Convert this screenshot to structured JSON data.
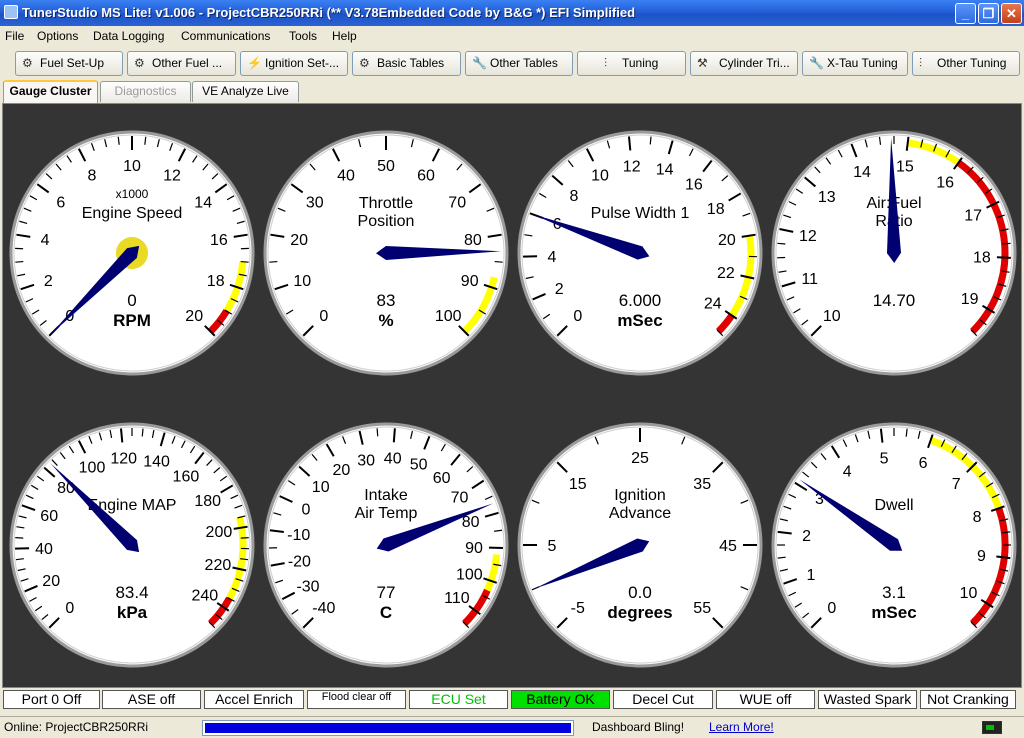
{
  "window": {
    "title": "TunerStudio MS Lite! v1.006 - ProjectCBR250RRi (** V3.78Embedded Code by B&G *) EFI Simplified",
    "minimize": "_",
    "maximize": "❐",
    "close": "✕"
  },
  "menu": [
    "File",
    "Options",
    "Data Logging",
    "Communications",
    "Tools",
    "Help"
  ],
  "toolbar": [
    {
      "label": "Fuel Set-Up",
      "icon": "engine-icon"
    },
    {
      "label": "Other Fuel ...",
      "icon": "engine-icon"
    },
    {
      "label": "Ignition Set-...",
      "icon": "spark-plug-icon"
    },
    {
      "label": "Basic Tables",
      "icon": "engine-icon"
    },
    {
      "label": "Other Tables",
      "icon": "wrench-icon"
    },
    {
      "label": "Tuning",
      "icon": "tuning-icon"
    },
    {
      "label": "Cylinder Tri...",
      "icon": "hammer-icon"
    },
    {
      "label": "X-Tau Tuning",
      "icon": "wrench-icon"
    },
    {
      "label": "Other Tuning",
      "icon": "tuning-icon"
    }
  ],
  "tabs": [
    {
      "label": "Gauge Cluster",
      "state": "active"
    },
    {
      "label": "Diagnostics",
      "state": "disabled"
    },
    {
      "label": "VE Analyze Live",
      "state": "normal"
    }
  ],
  "gauges": [
    {
      "title": [
        "Engine Speed"
      ],
      "top_label": "x1000",
      "value": "0",
      "units": "RPM",
      "min": 0,
      "max": 20,
      "major_step": 2,
      "minor_per_major": 4,
      "current": 0,
      "warn_from": 17,
      "danger_from": 19,
      "label_text": [
        "0",
        "2",
        "4",
        "6",
        "8",
        "10",
        "12",
        "14",
        "16",
        "18",
        "20"
      ]
    },
    {
      "title": [
        "Throttle",
        "Position"
      ],
      "value": "83",
      "units": "%",
      "min": 0,
      "max": 100,
      "major_step": 10,
      "minor_per_major": 2,
      "current": 83,
      "warn_from": 88,
      "danger_from": null,
      "label_text": [
        "0",
        "10",
        "20",
        "30",
        "40",
        "50",
        "60",
        "70",
        "80",
        "90",
        "100"
      ]
    },
    {
      "title": [
        "Pulse Width 1"
      ],
      "value": "6.000",
      "units": "mSec",
      "min": 0,
      "max": 25,
      "major_step": 2,
      "minor_per_major": 2,
      "current": 6,
      "warn_from": 20,
      "danger_from": 24,
      "label_text": [
        "0",
        "2",
        "4",
        "6",
        "8",
        "10",
        "12",
        "14",
        "16",
        "18",
        "20",
        "22",
        "24"
      ]
    },
    {
      "title": [
        "Air:Fuel",
        "Ratio"
      ],
      "value": "14.70",
      "units": "",
      "min": 10,
      "max": 19.5,
      "major_step": 1,
      "minor_per_major": 4,
      "current": 14.7,
      "warn_from": 15,
      "danger_from": 16,
      "label_text": [
        "10",
        "11",
        "12",
        "13",
        "14",
        "15",
        "16",
        "17",
        "18",
        "19"
      ]
    },
    {
      "title": [
        "Engine MAP"
      ],
      "value": "83.4",
      "units": "kPa",
      "min": 0,
      "max": 250,
      "major_step": 20,
      "minor_per_major": 4,
      "current": 83.4,
      "warn_from": 195,
      "danger_from": 235,
      "label_text": [
        "0",
        "20",
        "40",
        "60",
        "80",
        "100",
        "120",
        "140",
        "160",
        "180",
        "200",
        "220",
        "240"
      ]
    },
    {
      "title": [
        "Intake",
        "Air Temp"
      ],
      "value": "77",
      "units": "C",
      "min": -40,
      "max": 115,
      "major_step": 10,
      "minor_per_major": 2,
      "current": 77,
      "warn_from": 92,
      "danger_from": 103,
      "label_text": [
        "-40",
        "-30",
        "-20",
        "-10",
        "0",
        "10",
        "20",
        "30",
        "40",
        "50",
        "60",
        "70",
        "80",
        "90",
        "100",
        "110"
      ]
    },
    {
      "title": [
        "Ignition",
        "Advance"
      ],
      "value": "0.0",
      "units": "degrees",
      "min": -5,
      "max": 55,
      "major_step": 10,
      "minor_per_major": 2,
      "current": 0,
      "warn_from": null,
      "danger_from": null,
      "label_text": [
        "-5",
        "5",
        "15",
        "25",
        "35",
        "45",
        "55"
      ]
    },
    {
      "title": [
        "Dwell"
      ],
      "value": "3.1",
      "units": "mSec",
      "min": 0,
      "max": 10.5,
      "major_step": 1,
      "minor_per_major": 4,
      "current": 3.1,
      "warn_from": 6,
      "danger_from": 8,
      "label_text": [
        "0",
        "1",
        "2",
        "3",
        "4",
        "5",
        "6",
        "7",
        "8",
        "9",
        "10"
      ]
    }
  ],
  "indicators": [
    {
      "label": "Port 0 Off",
      "active": false
    },
    {
      "label": "ASE off",
      "active": false
    },
    {
      "label": "Accel Enrich",
      "active": false
    },
    {
      "label": "Flood clear off",
      "active": false
    },
    {
      "label": "ECU Set",
      "active": false,
      "text_color": "#00C000"
    },
    {
      "label": "Battery OK",
      "active": true
    },
    {
      "label": "Decel Cut",
      "active": false
    },
    {
      "label": "WUE off",
      "active": false
    },
    {
      "label": "Wasted Spark",
      "active": false
    },
    {
      "label": "Not Cranking",
      "active": false
    }
  ],
  "status": {
    "connection": "Online: ProjectCBR250RRi",
    "progress": 1.0,
    "ad_text": "Dashboard Bling!",
    "link": "Learn More!"
  },
  "colors": {
    "warning": "#FFFF00",
    "danger": "#E00000",
    "needle": "#000070",
    "indicator_on": "#00E000"
  }
}
